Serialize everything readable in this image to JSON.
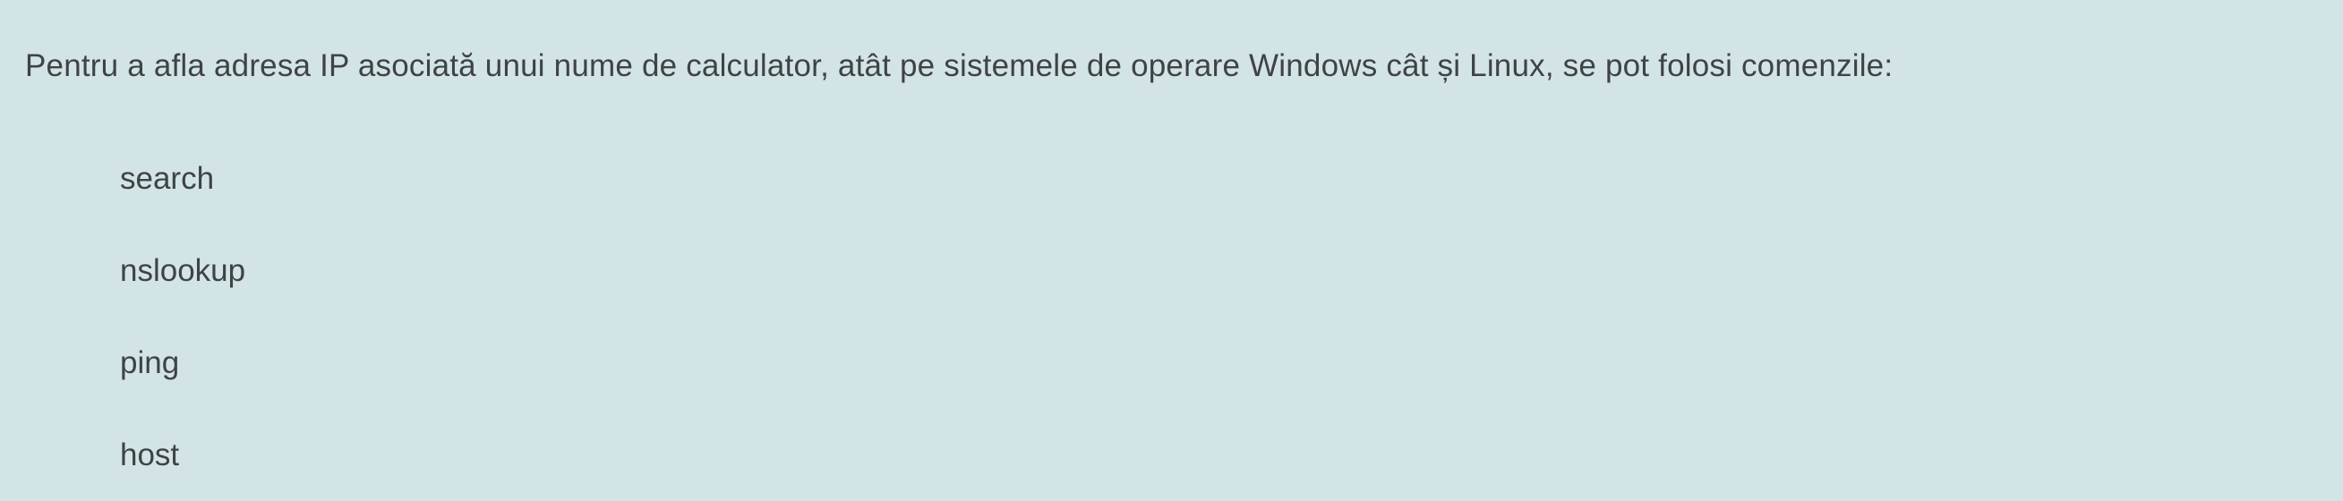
{
  "question": {
    "text": "Pentru a afla adresa IP asociată unui nume de calculator, atât pe sistemele de operare Windows cât și Linux, se pot folosi comenzile:",
    "options": [
      {
        "label": "search"
      },
      {
        "label": "nslookup"
      },
      {
        "label": "ping"
      },
      {
        "label": "host"
      }
    ]
  },
  "colors": {
    "background": "#d3e4e6",
    "text": "#3f4346"
  }
}
